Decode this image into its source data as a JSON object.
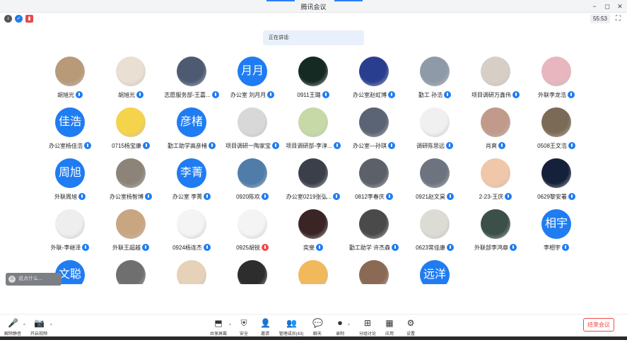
{
  "window": {
    "title": "腾讯会议",
    "controls": [
      "−",
      "◻",
      "✕"
    ],
    "timer": "55:53"
  },
  "banner": {
    "speaking": "正在讲话:"
  },
  "chat": {
    "placeholder": "说点什么..."
  },
  "colors": {
    "accent": "#1f7cf2",
    "end": "#f04a4a",
    "mic_on": "#1f7cf2",
    "mic_off": "#f04a4a"
  },
  "participants": [
    {
      "name": "胡旭光",
      "avatar": "photo",
      "color": "#b89a78"
    },
    {
      "name": "胡旭光",
      "avatar": "photo",
      "color": "#e9dfd2"
    },
    {
      "name": "志愿服务部-王嘉...",
      "avatar": "photo",
      "color": "#4e5a72"
    },
    {
      "name": "办公室 刘月月",
      "avatar": "text",
      "initials": "月月"
    },
    {
      "name": "0911王璐",
      "avatar": "photo",
      "color": "#152a22"
    },
    {
      "name": "办公室赵虹博",
      "avatar": "photo",
      "color": "#2a3e90"
    },
    {
      "name": "勤工 孙浩",
      "avatar": "photo",
      "color": "#8f9aa8"
    },
    {
      "name": "项目调研万鑫伟",
      "avatar": "photo",
      "color": "#d7cfc6"
    },
    {
      "name": "外联李龙浩",
      "avatar": "photo",
      "color": "#e8b6bf"
    },
    {
      "name": "办公室杨佳浩",
      "avatar": "text",
      "initials": "佳浩"
    },
    {
      "name": "0715杨宝康",
      "avatar": "photo",
      "color": "#f5d34b"
    },
    {
      "name": "勤工助学高彦楮",
      "avatar": "text",
      "initials": "彦楮"
    },
    {
      "name": "项目调研一陶家宝",
      "avatar": "photo",
      "color": "#d8d8d8"
    },
    {
      "name": "项目调研部-李淳...",
      "avatar": "photo",
      "color": "#c7d9a6"
    },
    {
      "name": "办公室—孙琪",
      "avatar": "photo",
      "color": "#5a6474"
    },
    {
      "name": "调研陈思远",
      "avatar": "photo",
      "color": "#f0f0f0"
    },
    {
      "name": "肖爽",
      "avatar": "photo",
      "color": "#c19a8c"
    },
    {
      "name": "0508王文浩",
      "avatar": "photo",
      "color": "#7b6a55"
    },
    {
      "name": "外联周旭",
      "avatar": "text",
      "initials": "周旭"
    },
    {
      "name": "办公室杨智博",
      "avatar": "photo",
      "color": "#8c8478"
    },
    {
      "name": "办公室 李菁",
      "avatar": "text",
      "initials": "李菁"
    },
    {
      "name": "0920陈欢",
      "avatar": "photo",
      "color": "#4f7ca8"
    },
    {
      "name": "办公室0219张弘...",
      "avatar": "photo",
      "color": "#3a3f4a"
    },
    {
      "name": "0812李春庆",
      "avatar": "photo",
      "color": "#5b6069"
    },
    {
      "name": "0921赵文昊",
      "avatar": "photo",
      "color": "#6d7480"
    },
    {
      "name": "2-23-王庆",
      "avatar": "photo",
      "color": "#f0c7a8"
    },
    {
      "name": "0629黎安署",
      "avatar": "photo",
      "color": "#15203a"
    },
    {
      "name": "外联-李继泽",
      "avatar": "photo",
      "color": "#eeeeee"
    },
    {
      "name": "外联王超越",
      "avatar": "photo",
      "color": "#c9a682"
    },
    {
      "name": "0924杨连杰",
      "avatar": "photo",
      "color": "#f4f4f4"
    },
    {
      "name": "0925胡锐",
      "avatar": "photo",
      "color": "#f4f4f4",
      "mic": "off"
    },
    {
      "name": "奕斐",
      "avatar": "photo",
      "color": "#3a2426"
    },
    {
      "name": "勤工助学 许杰森",
      "avatar": "photo",
      "color": "#4a4a4a"
    },
    {
      "name": "0623常佳康",
      "avatar": "photo",
      "color": "#dcdcd5"
    },
    {
      "name": "外联部李鸿章",
      "avatar": "photo",
      "color": "#3a5048"
    },
    {
      "name": "李相宇",
      "avatar": "text",
      "initials": "相宇"
    },
    {
      "name": "",
      "avatar": "text",
      "initials": "文聪"
    },
    {
      "name": "",
      "avatar": "photo",
      "color": "#6f6f6f"
    },
    {
      "name": "",
      "avatar": "photo",
      "color": "#e6d2b8"
    },
    {
      "name": "",
      "avatar": "photo",
      "color": "#2d2d2d"
    },
    {
      "name": "",
      "avatar": "photo",
      "color": "#f2b85c"
    },
    {
      "name": "",
      "avatar": "photo",
      "color": "#8a6a55"
    },
    {
      "name": "",
      "avatar": "text",
      "initials": "远洋"
    }
  ],
  "toolbar": {
    "left": [
      {
        "label": "解除静音",
        "icon": "🎤"
      },
      {
        "label": "开启视频",
        "icon": "📷"
      }
    ],
    "center": [
      {
        "label": "共享屏幕",
        "icon": "⬒"
      },
      {
        "label": "安全",
        "icon": "⛨"
      },
      {
        "label": "邀请",
        "icon": "👤"
      },
      {
        "label": "管理成员(43)",
        "icon": "👥"
      },
      {
        "label": "聊天",
        "icon": "💬"
      },
      {
        "label": "录制",
        "icon": "⏺"
      },
      {
        "label": "分组讨论",
        "icon": "⊞"
      },
      {
        "label": "应用",
        "icon": "▦"
      },
      {
        "label": "设置",
        "icon": "⚙"
      }
    ],
    "end_label": "结束会议"
  }
}
